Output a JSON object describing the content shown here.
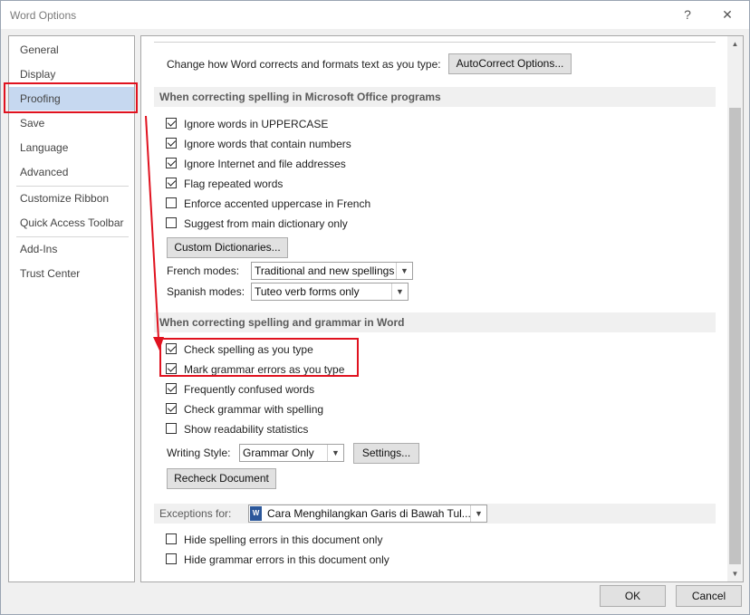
{
  "window": {
    "title": "Word Options",
    "help_glyph": "?",
    "close_glyph": "✕"
  },
  "sidebar": {
    "items": [
      {
        "label": "General"
      },
      {
        "label": "Display"
      },
      {
        "label": "Proofing",
        "selected": true
      },
      {
        "label": "Save"
      },
      {
        "label": "Language"
      },
      {
        "label": "Advanced"
      },
      {
        "label": "Customize Ribbon"
      },
      {
        "label": "Quick Access Toolbar"
      },
      {
        "label": "Add-Ins"
      },
      {
        "label": "Trust Center"
      }
    ]
  },
  "autocorrect": {
    "text": "Change how Word corrects and formats text as you type:",
    "button": "AutoCorrect Options..."
  },
  "office_section": {
    "heading": "When correcting spelling in Microsoft Office programs",
    "options": [
      {
        "label": "Ignore words in UPPERCASE",
        "checked": true
      },
      {
        "label": "Ignore words that contain numbers",
        "checked": true
      },
      {
        "label": "Ignore Internet and file addresses",
        "checked": true
      },
      {
        "label": "Flag repeated words",
        "checked": true
      },
      {
        "label": "Enforce accented uppercase in French",
        "checked": false
      },
      {
        "label": "Suggest from main dictionary only",
        "checked": false
      }
    ],
    "custom_dict_button": "Custom Dictionaries...",
    "french_label": "French modes:",
    "french_value": "Traditional and new spellings",
    "spanish_label": "Spanish modes:",
    "spanish_value": "Tuteo verb forms only"
  },
  "word_section": {
    "heading": "When correcting spelling and grammar in Word",
    "options": [
      {
        "label": "Check spelling as you type",
        "checked": true
      },
      {
        "label": "Mark grammar errors as you type",
        "checked": true
      },
      {
        "label": "Frequently confused words",
        "checked": true
      },
      {
        "label": "Check grammar with spelling",
        "checked": true
      },
      {
        "label": "Show readability statistics",
        "checked": false
      }
    ],
    "writing_style_label": "Writing Style:",
    "writing_style_value": "Grammar Only",
    "settings_button": "Settings...",
    "recheck_button": "Recheck Document"
  },
  "exceptions": {
    "label": "Exceptions for:",
    "doc_value": "Cara Menghilangkan Garis di Bawah Tul...",
    "options": [
      {
        "label": "Hide spelling errors in this document only",
        "checked": false
      },
      {
        "label": "Hide grammar errors in this document only",
        "checked": false
      }
    ]
  },
  "footer": {
    "ok": "OK",
    "cancel": "Cancel"
  },
  "colors": {
    "annotation": "#e0121f",
    "selected_nav": "#c6d8f0"
  },
  "icons": [
    "help-icon",
    "close-icon",
    "chevron-down-icon",
    "word-document-icon",
    "scroll-up-icon",
    "scroll-down-icon",
    "annotation-arrow"
  ]
}
